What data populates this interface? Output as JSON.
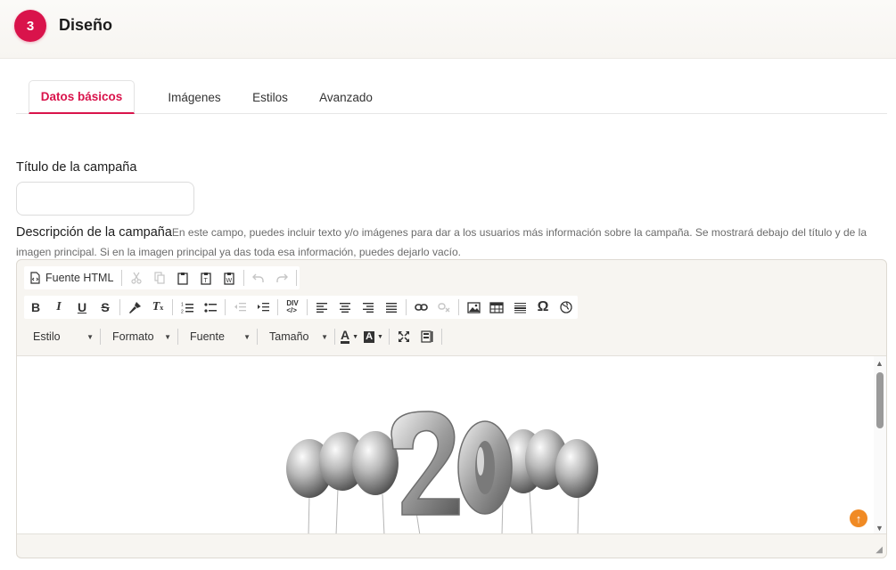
{
  "step": {
    "number": "3",
    "title": "Diseño"
  },
  "tabs": [
    {
      "label": "Datos básicos",
      "active": true
    },
    {
      "label": "Imágenes",
      "active": false
    },
    {
      "label": "Estilos",
      "active": false
    },
    {
      "label": "Avanzado",
      "active": false
    }
  ],
  "fields": {
    "title_label": "Título de la campaña",
    "title_value": "",
    "description_label": "Descripción de la campaña",
    "description_help": "En este campo, puedes incluir texto y/o imágenes para dar a los usuarios más información sobre la campaña. Se mostrará debajo del título y de la imagen principal. Si en la imagen principal ya das toda esa información, puedes dejarlo vacío."
  },
  "editor": {
    "source_label": "Fuente HTML",
    "combos": {
      "style": "Estilo",
      "format": "Formato",
      "font": "Fuente",
      "size": "Tamaño"
    },
    "image_number": "20"
  },
  "colors": {
    "accent": "#d9134b",
    "balloon": "#b9b9b9",
    "badge": "#f08a24"
  }
}
